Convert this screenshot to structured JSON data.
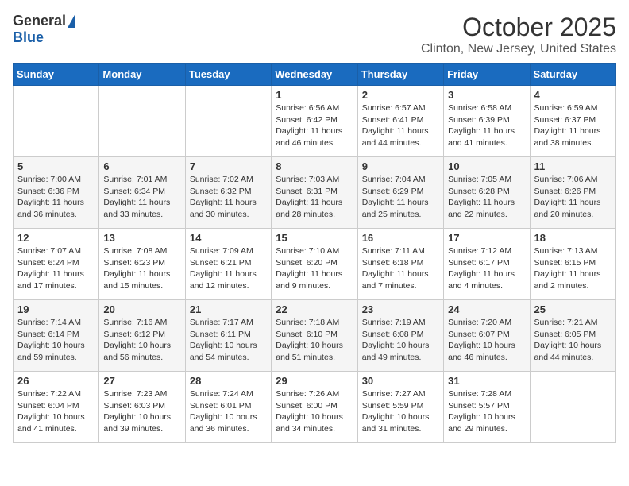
{
  "header": {
    "logo_general": "General",
    "logo_blue": "Blue",
    "month_title": "October 2025",
    "location": "Clinton, New Jersey, United States"
  },
  "days_of_week": [
    "Sunday",
    "Monday",
    "Tuesday",
    "Wednesday",
    "Thursday",
    "Friday",
    "Saturday"
  ],
  "weeks": [
    [
      {
        "day": "",
        "info": ""
      },
      {
        "day": "",
        "info": ""
      },
      {
        "day": "",
        "info": ""
      },
      {
        "day": "1",
        "info": "Sunrise: 6:56 AM\nSunset: 6:42 PM\nDaylight: 11 hours and 46 minutes."
      },
      {
        "day": "2",
        "info": "Sunrise: 6:57 AM\nSunset: 6:41 PM\nDaylight: 11 hours and 44 minutes."
      },
      {
        "day": "3",
        "info": "Sunrise: 6:58 AM\nSunset: 6:39 PM\nDaylight: 11 hours and 41 minutes."
      },
      {
        "day": "4",
        "info": "Sunrise: 6:59 AM\nSunset: 6:37 PM\nDaylight: 11 hours and 38 minutes."
      }
    ],
    [
      {
        "day": "5",
        "info": "Sunrise: 7:00 AM\nSunset: 6:36 PM\nDaylight: 11 hours and 36 minutes."
      },
      {
        "day": "6",
        "info": "Sunrise: 7:01 AM\nSunset: 6:34 PM\nDaylight: 11 hours and 33 minutes."
      },
      {
        "day": "7",
        "info": "Sunrise: 7:02 AM\nSunset: 6:32 PM\nDaylight: 11 hours and 30 minutes."
      },
      {
        "day": "8",
        "info": "Sunrise: 7:03 AM\nSunset: 6:31 PM\nDaylight: 11 hours and 28 minutes."
      },
      {
        "day": "9",
        "info": "Sunrise: 7:04 AM\nSunset: 6:29 PM\nDaylight: 11 hours and 25 minutes."
      },
      {
        "day": "10",
        "info": "Sunrise: 7:05 AM\nSunset: 6:28 PM\nDaylight: 11 hours and 22 minutes."
      },
      {
        "day": "11",
        "info": "Sunrise: 7:06 AM\nSunset: 6:26 PM\nDaylight: 11 hours and 20 minutes."
      }
    ],
    [
      {
        "day": "12",
        "info": "Sunrise: 7:07 AM\nSunset: 6:24 PM\nDaylight: 11 hours and 17 minutes."
      },
      {
        "day": "13",
        "info": "Sunrise: 7:08 AM\nSunset: 6:23 PM\nDaylight: 11 hours and 15 minutes."
      },
      {
        "day": "14",
        "info": "Sunrise: 7:09 AM\nSunset: 6:21 PM\nDaylight: 11 hours and 12 minutes."
      },
      {
        "day": "15",
        "info": "Sunrise: 7:10 AM\nSunset: 6:20 PM\nDaylight: 11 hours and 9 minutes."
      },
      {
        "day": "16",
        "info": "Sunrise: 7:11 AM\nSunset: 6:18 PM\nDaylight: 11 hours and 7 minutes."
      },
      {
        "day": "17",
        "info": "Sunrise: 7:12 AM\nSunset: 6:17 PM\nDaylight: 11 hours and 4 minutes."
      },
      {
        "day": "18",
        "info": "Sunrise: 7:13 AM\nSunset: 6:15 PM\nDaylight: 11 hours and 2 minutes."
      }
    ],
    [
      {
        "day": "19",
        "info": "Sunrise: 7:14 AM\nSunset: 6:14 PM\nDaylight: 10 hours and 59 minutes."
      },
      {
        "day": "20",
        "info": "Sunrise: 7:16 AM\nSunset: 6:12 PM\nDaylight: 10 hours and 56 minutes."
      },
      {
        "day": "21",
        "info": "Sunrise: 7:17 AM\nSunset: 6:11 PM\nDaylight: 10 hours and 54 minutes."
      },
      {
        "day": "22",
        "info": "Sunrise: 7:18 AM\nSunset: 6:10 PM\nDaylight: 10 hours and 51 minutes."
      },
      {
        "day": "23",
        "info": "Sunrise: 7:19 AM\nSunset: 6:08 PM\nDaylight: 10 hours and 49 minutes."
      },
      {
        "day": "24",
        "info": "Sunrise: 7:20 AM\nSunset: 6:07 PM\nDaylight: 10 hours and 46 minutes."
      },
      {
        "day": "25",
        "info": "Sunrise: 7:21 AM\nSunset: 6:05 PM\nDaylight: 10 hours and 44 minutes."
      }
    ],
    [
      {
        "day": "26",
        "info": "Sunrise: 7:22 AM\nSunset: 6:04 PM\nDaylight: 10 hours and 41 minutes."
      },
      {
        "day": "27",
        "info": "Sunrise: 7:23 AM\nSunset: 6:03 PM\nDaylight: 10 hours and 39 minutes."
      },
      {
        "day": "28",
        "info": "Sunrise: 7:24 AM\nSunset: 6:01 PM\nDaylight: 10 hours and 36 minutes."
      },
      {
        "day": "29",
        "info": "Sunrise: 7:26 AM\nSunset: 6:00 PM\nDaylight: 10 hours and 34 minutes."
      },
      {
        "day": "30",
        "info": "Sunrise: 7:27 AM\nSunset: 5:59 PM\nDaylight: 10 hours and 31 minutes."
      },
      {
        "day": "31",
        "info": "Sunrise: 7:28 AM\nSunset: 5:57 PM\nDaylight: 10 hours and 29 minutes."
      },
      {
        "day": "",
        "info": ""
      }
    ]
  ]
}
